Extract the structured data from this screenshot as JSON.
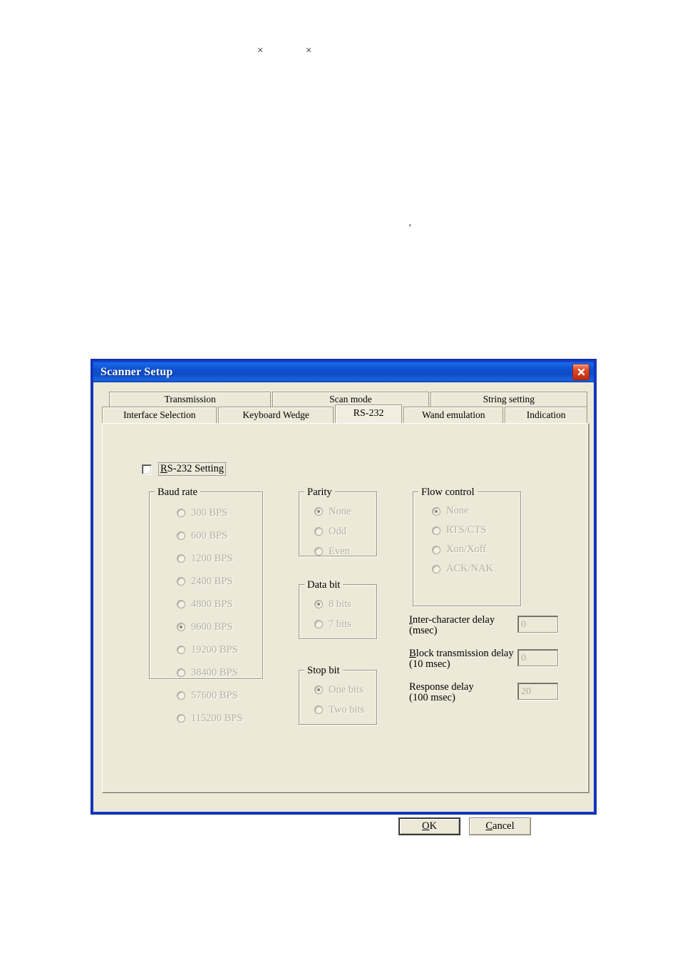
{
  "page": {
    "stray_marks": [
      "×",
      "×",
      "’"
    ]
  },
  "dialog": {
    "title": "Scanner Setup",
    "close_icon": "close-icon",
    "tabs_row1": [
      {
        "label": "Transmission",
        "selected": false
      },
      {
        "label": "Scan mode",
        "selected": false
      },
      {
        "label": "String setting",
        "selected": false
      }
    ],
    "tabs_row2": [
      {
        "label": "Interface Selection",
        "selected": false
      },
      {
        "label": "Keyboard Wedge",
        "selected": false
      },
      {
        "label": "RS-232",
        "selected": true
      },
      {
        "label": "Wand emulation",
        "selected": false
      },
      {
        "label": "Indication",
        "selected": false
      }
    ],
    "enable_checkbox": {
      "label_prefix": "R",
      "label_rest": "S-232 Setting",
      "checked": false
    },
    "groups": {
      "baud_rate": {
        "title": "Baud rate",
        "options": [
          {
            "label": "300 BPS",
            "selected": false
          },
          {
            "label": "600 BPS",
            "selected": false
          },
          {
            "label": "1200 BPS",
            "selected": false
          },
          {
            "label": "2400 BPS",
            "selected": false
          },
          {
            "label": "4800 BPS",
            "selected": false
          },
          {
            "label": "9600 BPS",
            "selected": true
          },
          {
            "label": "19200 BPS",
            "selected": false
          },
          {
            "label": "38400 BPS",
            "selected": false
          },
          {
            "label": "57600 BPS",
            "selected": false
          },
          {
            "label": "115200 BPS",
            "selected": false
          }
        ]
      },
      "parity": {
        "title": "Parity",
        "options": [
          {
            "label": "None",
            "selected": true
          },
          {
            "label": "Odd",
            "selected": false
          },
          {
            "label": "Even",
            "selected": false
          }
        ]
      },
      "data_bit": {
        "title": "Data bit",
        "options": [
          {
            "label": "8 bits",
            "selected": true
          },
          {
            "label": "7 bits",
            "selected": false
          }
        ]
      },
      "stop_bit": {
        "title": "Stop bit",
        "options": [
          {
            "label": "One bits",
            "selected": true
          },
          {
            "label": "Two bits",
            "selected": false
          }
        ]
      },
      "flow_control": {
        "title": "Flow control",
        "options": [
          {
            "label": "None",
            "selected": true
          },
          {
            "label": "RTS/CTS",
            "selected": false
          },
          {
            "label": "Xon/Xoff",
            "selected": false
          },
          {
            "label": "ACK/NAK",
            "selected": false
          }
        ]
      }
    },
    "delays": [
      {
        "accel": "I",
        "label_rest": "nter-character delay",
        "label_line2": "(msec)",
        "value": "0"
      },
      {
        "accel": "B",
        "label_rest": "lock transmission delay",
        "label_line2": "(10 msec)",
        "value": "0"
      },
      {
        "accel": "",
        "label_rest": "Response delay",
        "label_line2": "(100 msec)",
        "value": "20"
      }
    ],
    "buttons": {
      "ok_accel": "O",
      "ok_rest": "K",
      "cancel_accel": "C",
      "cancel_rest": "ancel"
    }
  }
}
